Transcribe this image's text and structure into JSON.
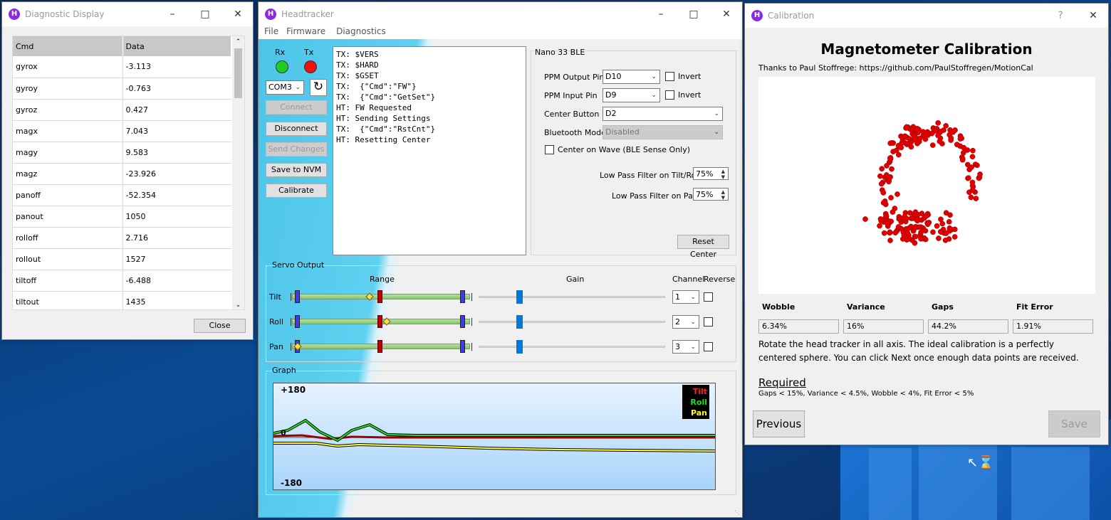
{
  "diagnostic": {
    "title": "Diagnostic Display",
    "col_cmd": "Cmd",
    "col_data": "Data",
    "rows": [
      {
        "cmd": "gyrox",
        "data": "-3.113"
      },
      {
        "cmd": "gyroy",
        "data": "-0.763"
      },
      {
        "cmd": "gyroz",
        "data": "0.427"
      },
      {
        "cmd": "magx",
        "data": "7.043"
      },
      {
        "cmd": "magy",
        "data": "9.583"
      },
      {
        "cmd": "magz",
        "data": "-23.926"
      },
      {
        "cmd": "panoff",
        "data": "-52.354"
      },
      {
        "cmd": "panout",
        "data": "1050"
      },
      {
        "cmd": "rolloff",
        "data": "2.716"
      },
      {
        "cmd": "rollout",
        "data": "1527"
      },
      {
        "cmd": "tiltoff",
        "data": "-6.488"
      },
      {
        "cmd": "tiltout",
        "data": "1435"
      }
    ],
    "close_label": "Close"
  },
  "headtracker": {
    "title": "Headtracker",
    "menu": [
      "File",
      "Firmware",
      "Diagnostics"
    ],
    "rx_label": "Rx",
    "tx_label": "Tx",
    "rx_color": "#22cc22",
    "tx_color": "#ee1111",
    "port": "COM3",
    "buttons": {
      "connect": "Connect",
      "disconnect": "Disconnect",
      "send_changes": "Send Changes",
      "save_nvm": "Save to NVM",
      "calibrate": "Calibrate",
      "reset_center": "Reset Center"
    },
    "log": "TX: $VERS\nTX: $HARD\nTX: $GSET\nTX:  {\"Cmd\":\"FW\"}\nTX:  {\"Cmd\":\"GetSet\"}\nHT: FW Requested\nHT: Sending Settings\nTX:  {\"Cmd\":\"RstCnt\"}\nHT: Resetting Center",
    "board": {
      "title": "Nano 33 BLE",
      "ppm_out_label": "PPM Output Pin",
      "ppm_out": "D10",
      "ppm_in_label": "PPM Input Pin",
      "ppm_in": "D9",
      "invert_label": "Invert",
      "center_button_label": "Center Button",
      "center_button": "D2",
      "bt_mode_label": "Bluetooth Mode",
      "bt_mode": "Disabled",
      "center_wave_label": "Center on Wave (BLE Sense Only)",
      "lpf_tilt_label": "Low Pass Filter on Tilt/Roll",
      "lpf_tilt": "75%",
      "lpf_pan_label": "Low Pass Filter on Pan",
      "lpf_pan": "75%"
    },
    "servo": {
      "title": "Servo Output",
      "range_label": "Range",
      "gain_label": "Gain",
      "channel_label": "Channel",
      "reverse_label": "Reverse",
      "rows": [
        {
          "name": "Tilt",
          "channel": "1",
          "value": 0.42
        },
        {
          "name": "Roll",
          "channel": "2",
          "value": 0.52
        },
        {
          "name": "Pan",
          "channel": "3",
          "value": 0.0
        }
      ]
    },
    "graph": {
      "title": "Graph",
      "top": "+180",
      "zero": "0",
      "bottom": "-180",
      "legend": [
        "Tilt",
        "Roll",
        "Pan"
      ],
      "legend_colors": [
        "#ff2020",
        "#20e020",
        "#ffff20"
      ]
    }
  },
  "calibration": {
    "title": "Calibration",
    "heading": "Magnetometer Calibration",
    "thanks": "Thanks to Paul Stoffrege: https://github.com/PaulStoffregen/MotionCal",
    "stats": [
      {
        "label": "Wobble",
        "value": "6.34%"
      },
      {
        "label": "Variance",
        "value": "16%"
      },
      {
        "label": "Gaps",
        "value": "44.2%"
      },
      {
        "label": "Fit Error",
        "value": "1.91%"
      }
    ],
    "instructions": "Rotate the head tracker in all axis. The ideal calibration is a perfectly centered sphere. You can click Next once enough data points are received.",
    "required_label": "Required",
    "required_text": "Gaps < 15%, Variance < 4.5%, Wobble < 4%, Fit Error < 5%",
    "previous_label": "Previous",
    "save_label": "Save",
    "help_label": "?"
  }
}
